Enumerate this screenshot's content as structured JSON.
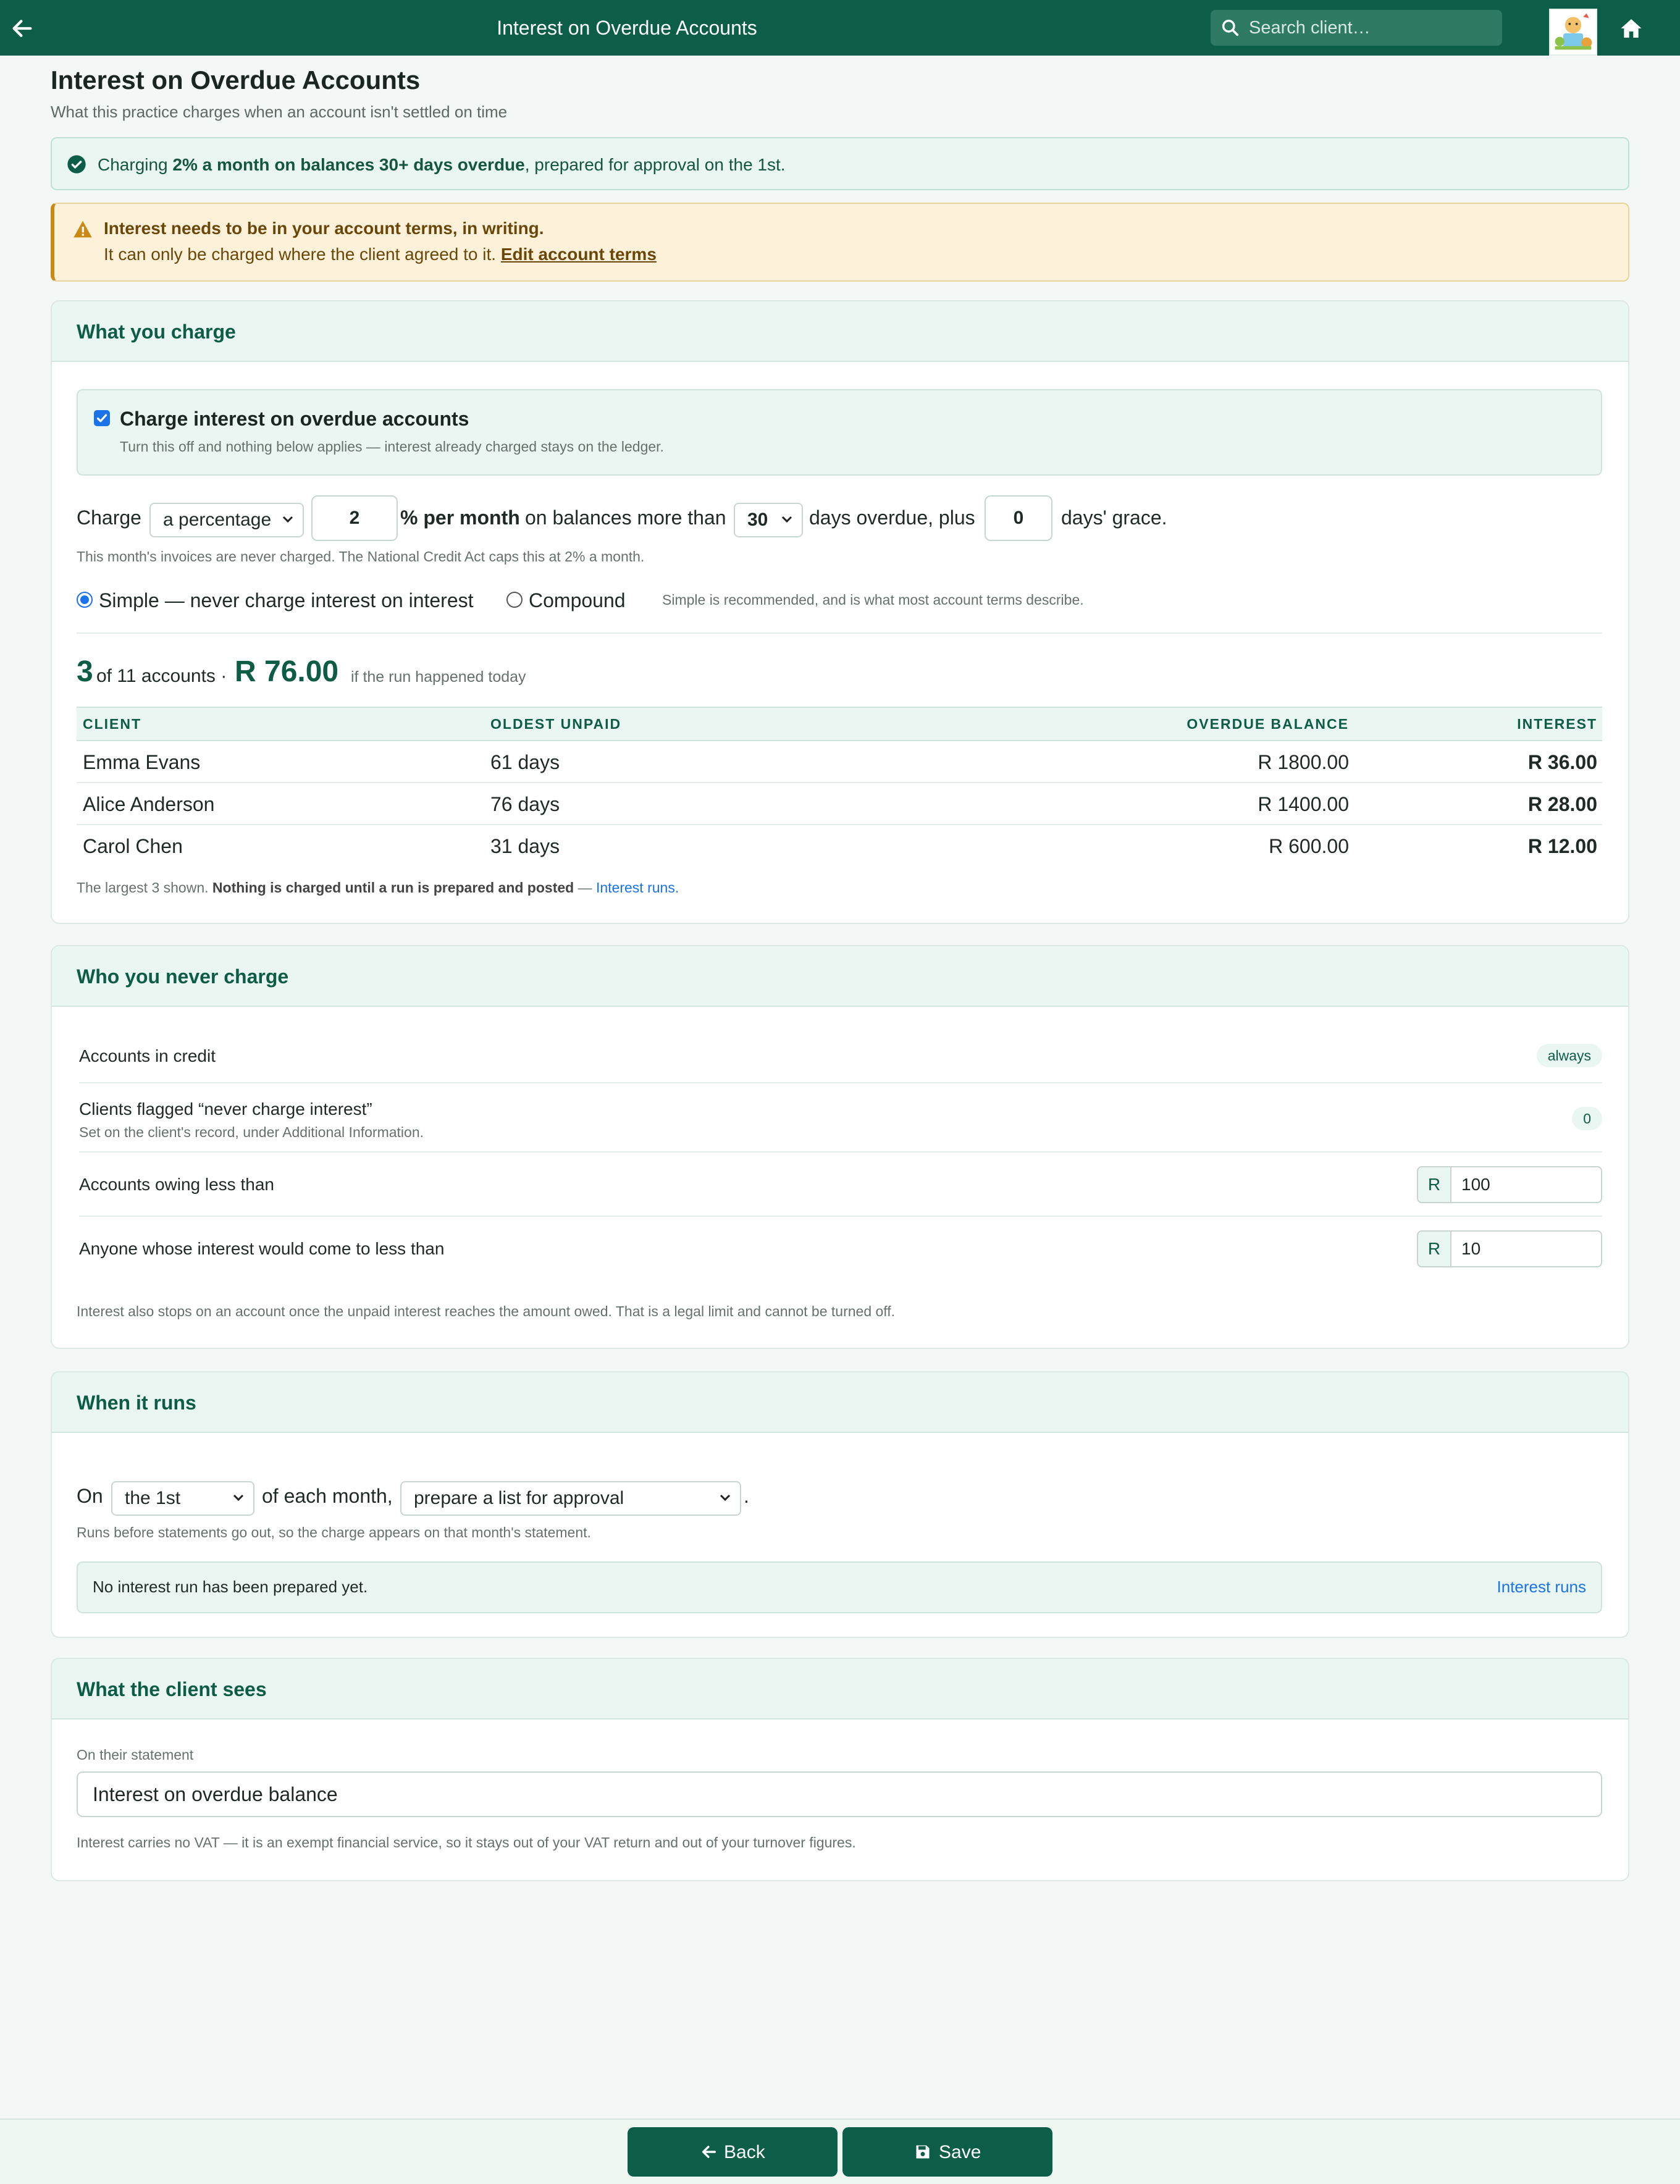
{
  "app": {
    "title": "Interest on Overdue Accounts",
    "search_placeholder": "Search client…",
    "brand_color": "#0c5e48"
  },
  "page": {
    "title": "Interest on Overdue Accounts",
    "subtitle": "What this practice charges when an account isn't settled on time"
  },
  "status_banner": {
    "prefix": "Charging ",
    "bold": "2% a month on balances 30+ days overdue",
    "suffix": ", prepared for approval on the 1st.",
    "icon": "check-circle-icon"
  },
  "warning_banner": {
    "title": "Interest needs to be in your account terms, in writing.",
    "body": "It can only be charged where the client agreed to it. ",
    "link": "Edit account terms",
    "icon": "warning-triangle-icon"
  },
  "charge_card": {
    "heading": "What you charge",
    "toggle_label": "Charge interest on overdue accounts",
    "toggle_checked": true,
    "toggle_hint": "Turn this off and nothing below applies — interest already charged stays on the ledger.",
    "charge_label": "Charge",
    "method": "a percentage",
    "rate": "2",
    "rate_suffix": "% per month",
    "balances_text": "on balances more than",
    "days": "30",
    "overdue_text": "days overdue, plus",
    "grace": "0",
    "grace_text": "days' grace.",
    "note": "This month's invoices are never charged. The National Credit Act caps this at 2% a month.",
    "simple_label": "Simple — never charge interest on interest",
    "compound_label": "Compound",
    "selected_mode": "simple",
    "mode_hint": "Simple is recommended, and is what most account terms describe.",
    "summary": {
      "count": "3",
      "of_text": "of 11 accounts ·",
      "total": "R 76.00",
      "when": "if the run happened today"
    },
    "table": {
      "headers": [
        "CLIENT",
        "OLDEST UNPAID",
        "OVERDUE BALANCE",
        "INTEREST"
      ],
      "rows": [
        {
          "client": "Emma Evans",
          "oldest": "61 days",
          "balance": "R 1800.00",
          "interest": "R 36.00"
        },
        {
          "client": "Alice Anderson",
          "oldest": "76 days",
          "balance": "R 1400.00",
          "interest": "R 28.00"
        },
        {
          "client": "Carol Chen",
          "oldest": "31 days",
          "balance": "R 600.00",
          "interest": "R 12.00"
        }
      ]
    },
    "footnote_a": "The largest 3 shown. ",
    "footnote_b": "Nothing is charged until a run is prepared and posted",
    "footnote_c": " — ",
    "footnote_link": "Interest runs."
  },
  "exempt_card": {
    "heading": "Who you never charge",
    "rows": [
      {
        "label": "Accounts in credit",
        "badge": "always"
      },
      {
        "label": "Clients flagged “never charge interest”",
        "sub": "Set on the client's record, under Additional Information.",
        "badge": "0"
      },
      {
        "label": "Accounts owing less than",
        "currency": "R",
        "value": "100"
      },
      {
        "label": "Anyone whose interest would come to less than",
        "currency": "R",
        "value": "10"
      }
    ],
    "note": "Interest also stops on an account once the unpaid interest reaches the amount owed. That is a legal limit and cannot be turned off."
  },
  "schedule_card": {
    "heading": "When it runs",
    "on_label": "On",
    "day": "the 1st",
    "each_month": "of each month,",
    "action": "prepare a list for approval",
    "period": ".",
    "hint": "Runs before statements go out, so the charge appears on that month's statement.",
    "status": "No interest run has been prepared yet.",
    "link": "Interest runs"
  },
  "client_card": {
    "heading": "What the client sees",
    "field_label": "On their statement",
    "field_value": "Interest on overdue balance",
    "note": "Interest carries no VAT — it is an exempt financial service, so it stays out of your VAT return and out of your turnover figures."
  },
  "footer": {
    "back_label": "Back",
    "save_label": "Save"
  }
}
